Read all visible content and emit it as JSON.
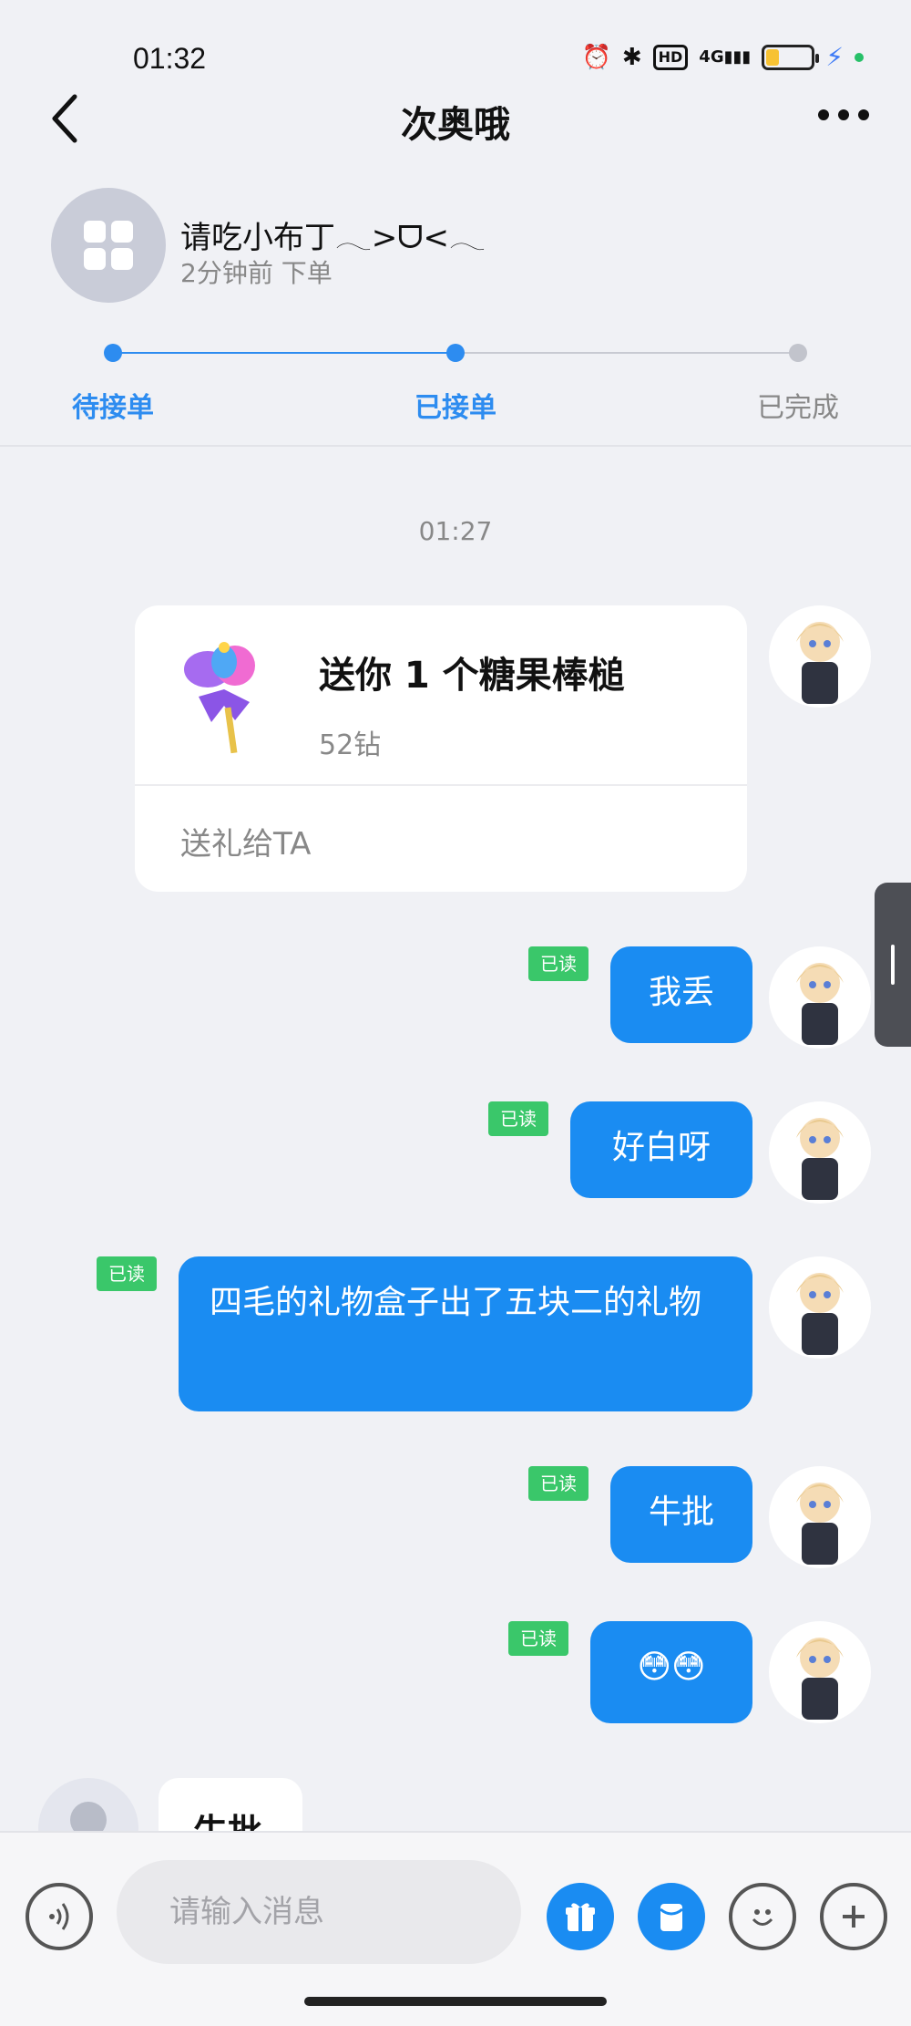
{
  "status_bar": {
    "time": "01:32",
    "icons": [
      "alarm-icon",
      "bluetooth-icon",
      "hd-icon",
      "4g-signal-icon",
      "battery-icon",
      "charging-icon"
    ],
    "hd_label": "HD",
    "network_label": "4G"
  },
  "nav": {
    "title": "次奥哦",
    "back_icon": "chevron-left-icon",
    "more_icon": "more-dots-icon"
  },
  "order": {
    "name": "请吃小布丁𓂃>ᗜ<𓂃",
    "subtitle": "2分钟前 下单",
    "steps": [
      {
        "label": "待接单",
        "state": "done"
      },
      {
        "label": "已接单",
        "state": "current"
      },
      {
        "label": "已完成",
        "state": "pending"
      }
    ],
    "progress_fraction": 0.5
  },
  "chat": {
    "timestamp": "01:27",
    "gift_card": {
      "title": "送你 1 个糖果棒槌",
      "price": "52钻",
      "action": "送礼给TA"
    },
    "messages": [
      {
        "text": "我丢",
        "read": "已读"
      },
      {
        "text": "好白呀",
        "read": "已读"
      },
      {
        "text": "四毛的礼物盒子出了五块二的礼物",
        "read": "已读"
      },
      {
        "text": "牛批",
        "read": "已读"
      },
      {
        "text": "😳😳",
        "read": "已读"
      }
    ],
    "incoming": {
      "text": "牛批"
    }
  },
  "input_bar": {
    "placeholder": "请输入消息",
    "buttons": [
      "voice-icon",
      "gift-icon",
      "red-packet-icon",
      "emoji-icon",
      "plus-icon"
    ]
  },
  "colors": {
    "accent": "#1a8cf2",
    "read_tag": "#3ac76a",
    "background": "#f0f1f5"
  }
}
